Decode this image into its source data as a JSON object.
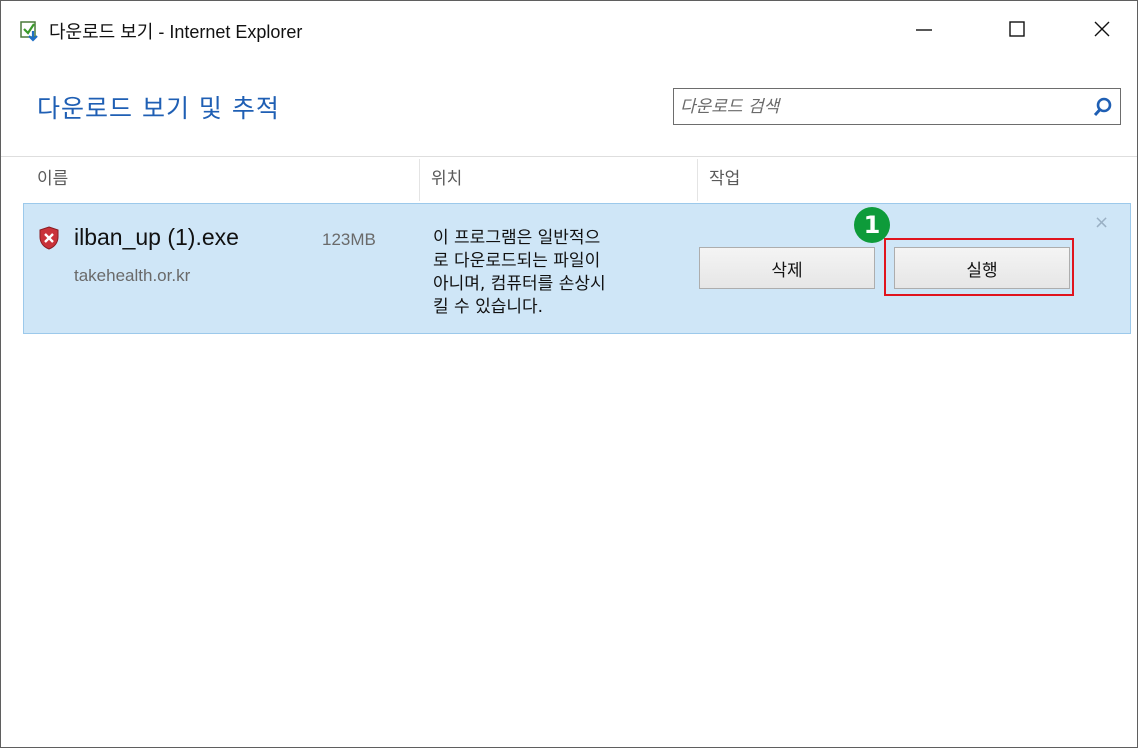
{
  "window": {
    "title": "다운로드 보기 - Internet Explorer",
    "controls": {
      "minimize": "minimize",
      "maximize": "maximize",
      "close": "close"
    }
  },
  "header": {
    "title": "다운로드 보기 및 추적",
    "search": {
      "placeholder": "다운로드 검색",
      "value": ""
    }
  },
  "columns": {
    "name": "이름",
    "location": "위치",
    "action": "작업"
  },
  "downloads": [
    {
      "file_name": "ilban_up (1).exe",
      "size": "123MB",
      "source": "takehealth.or.kr",
      "warning_lines": [
        "이 프로그램은 일반적으",
        "로 다운로드되는 파일이",
        "아니며, 컴퓨터를 손상시",
        "킬 수 있습니다."
      ],
      "delete_label": "삭제",
      "run_label": "실행",
      "close_glyph": "×"
    }
  ],
  "annotation": {
    "step": "1",
    "color": "#0e9b3a",
    "highlight_color": "#e0141e"
  },
  "colors": {
    "accent": "#1f5fb4",
    "row_selected": "#cfe6f7"
  },
  "icons": [
    "download-manager-icon",
    "minimize-icon",
    "maximize-icon",
    "close-icon",
    "search-icon",
    "shield-warning-icon"
  ]
}
